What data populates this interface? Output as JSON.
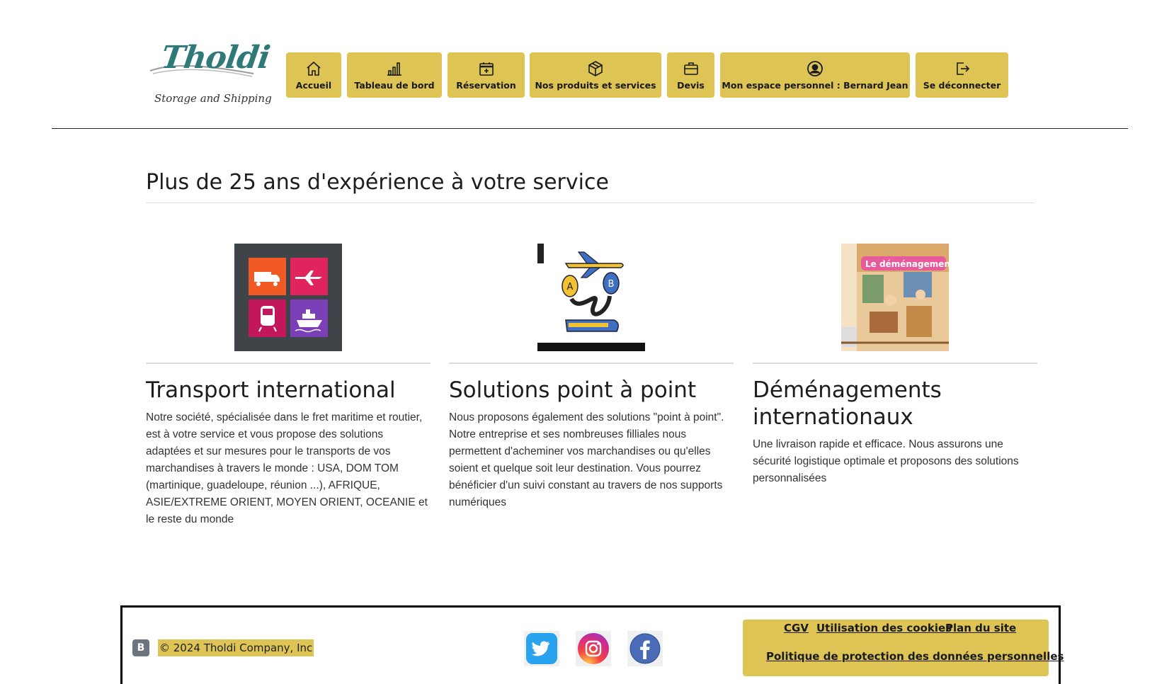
{
  "header": {
    "logo": {
      "brand": "Tholdi",
      "tagline": "Storage and Shipping"
    },
    "nav": [
      {
        "label": "Accueil",
        "icon": "home-icon"
      },
      {
        "label": "Tableau de bord",
        "icon": "bar-chart-icon"
      },
      {
        "label": "Réservation",
        "icon": "calendar-plus-icon"
      },
      {
        "label": "Nos produits et services",
        "icon": "box-icon"
      },
      {
        "label": "Devis",
        "icon": "briefcase-icon"
      },
      {
        "label": "Mon espace personnel : Bernard Jean",
        "icon": "user-circle-icon"
      },
      {
        "label": "Se déconnecter",
        "icon": "logout-icon"
      }
    ]
  },
  "main": {
    "title": "Plus de 25 ans d'expérience à votre service",
    "columns": [
      {
        "heading": "Transport international",
        "image": "transport-modes-tiles",
        "text": "Notre société, spécialisée dans le fret maritime et routier, est à votre service et vous propose des solutions adaptées et sur mesures pour le transports de vos marchandises à travers le monde : USA, DOM TOM (martinique, guadeloupe, réunion ...), AFRIQUE, ASIE/EXTREME ORIENT, MOYEN ORIENT, OCEANIE et le reste du monde"
      },
      {
        "heading": "Solutions point à point",
        "image": "plane-train-a-to-b-illustration",
        "text": "Nous proposons également des solutions \"point à point\". Notre entreprise et ses nombreuses filliales nous permettent d'acheminer vos marchandises ou qu'elles soient et quelque soit leur destination. Vous pourrez bénéficier d'un suivi constant au travers de nos supports numériques"
      },
      {
        "heading": "Déménagements internationaux",
        "image": "moving-book-cover",
        "image_title": "Le déménagement",
        "text": "Une livraison rapide et efficace. Nous assurons une sécurité logistique optimale et proposons des solutions personnalisées"
      }
    ]
  },
  "footer": {
    "bootstrap_badge": "B",
    "copyright": "© 2024 Tholdi Company, Inc",
    "social": [
      "twitter-icon",
      "instagram-icon",
      "facebook-icon"
    ],
    "links": {
      "cgv": "CGV",
      "cookies": "Utilisation des cookies",
      "sitemap": "Plan du site",
      "privacy": "Politique de protection des données personnelles"
    }
  },
  "colors": {
    "accent": "#ddc454",
    "brand_teal": "#2f7a78"
  }
}
